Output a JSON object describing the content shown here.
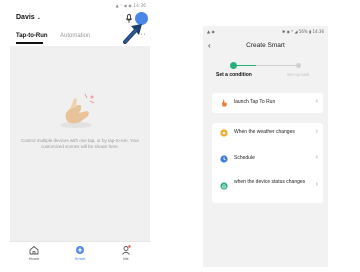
{
  "left_screen": {
    "status_bar": "▲ ᵀ ◀ ◉ 14:36",
    "home_name": "Davis",
    "caret": "⌄",
    "tabs": [
      {
        "label": "Tap-to-Run",
        "active": true
      },
      {
        "label": "Automation",
        "active": false
      }
    ],
    "more": "···",
    "empty_message": "Control multiple devices with one tap, or by tap-to-run. Your customized scenes will be shown here.",
    "bottom_nav": [
      {
        "label": "Home",
        "icon": "home-icon",
        "active": false
      },
      {
        "label": "Smart",
        "icon": "smart-icon",
        "active": true
      },
      {
        "label": "Me",
        "icon": "me-icon",
        "active": false
      }
    ],
    "colors": {
      "accent": "#4a86e8",
      "empty_bg": "#f0f0f0"
    }
  },
  "right_screen": {
    "status_left": "▲ ◉",
    "status_right": "✱ ◉ ᴺ ◢ 56% ▮ 14:36",
    "back": "‹",
    "title": "Create Smart",
    "steps": [
      {
        "label": "Set a condition",
        "active": true
      },
      {
        "label": "Set up task",
        "active": false
      }
    ],
    "progress": 0.35,
    "cards": [
      {
        "rows": [
          {
            "label": "launch Tap To Run",
            "icon": "hand-tap-icon",
            "color": "#f07a3a"
          }
        ]
      },
      {
        "rows": [
          {
            "label": "When the weather changes",
            "icon": "sun-icon",
            "color": "#f5a623"
          },
          {
            "label": "Schedule",
            "icon": "clock-icon",
            "color": "#3d7be0"
          },
          {
            "label": "when the device status changes",
            "icon": "device-icon",
            "color": "#26b07a"
          }
        ]
      }
    ],
    "chevron": "›",
    "colors": {
      "accent": "#26b07a",
      "bg": "#f2f2f2"
    }
  }
}
